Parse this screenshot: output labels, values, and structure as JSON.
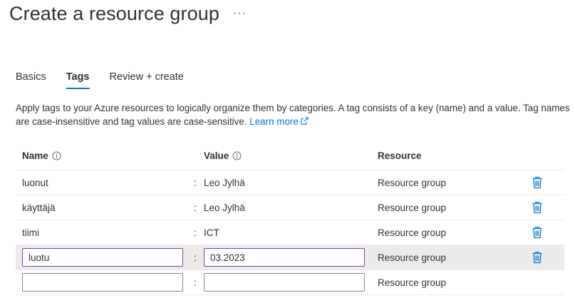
{
  "header": {
    "title": "Create a resource group",
    "more_label": "···"
  },
  "tabs": [
    {
      "label": "Basics",
      "active": false
    },
    {
      "label": "Tags",
      "active": true
    },
    {
      "label": "Review + create",
      "active": false
    }
  ],
  "description": {
    "text": "Apply tags to your Azure resources to logically organize them by categories. A tag consists of a key (name) and a value. Tag names are case-insensitive and tag values are case-sensitive.",
    "link_label": "Learn more"
  },
  "table": {
    "headers": {
      "name": "Name",
      "value": "Value",
      "resource": "Resource"
    },
    "separator": ":",
    "rows": [
      {
        "name": "luonut",
        "value": "Leo Jylhä",
        "resource": "Resource group",
        "editing": false
      },
      {
        "name": "käyttäjä",
        "value": "Leo Jylhä",
        "resource": "Resource group",
        "editing": false
      },
      {
        "name": "tiimi",
        "value": "ICT",
        "resource": "Resource group",
        "editing": false
      },
      {
        "name": "luotu",
        "value": "03.2023",
        "resource": "Resource group",
        "editing": true
      },
      {
        "name": "",
        "value": "",
        "resource": "Resource group",
        "editing": true
      }
    ]
  },
  "colors": {
    "accent": "#0078d4",
    "active_input_border": "#7a3fb0",
    "selected_row": "#edebe9"
  },
  "icons": {
    "delete": "trash-icon",
    "info": "info-icon",
    "external": "external-link-icon"
  }
}
